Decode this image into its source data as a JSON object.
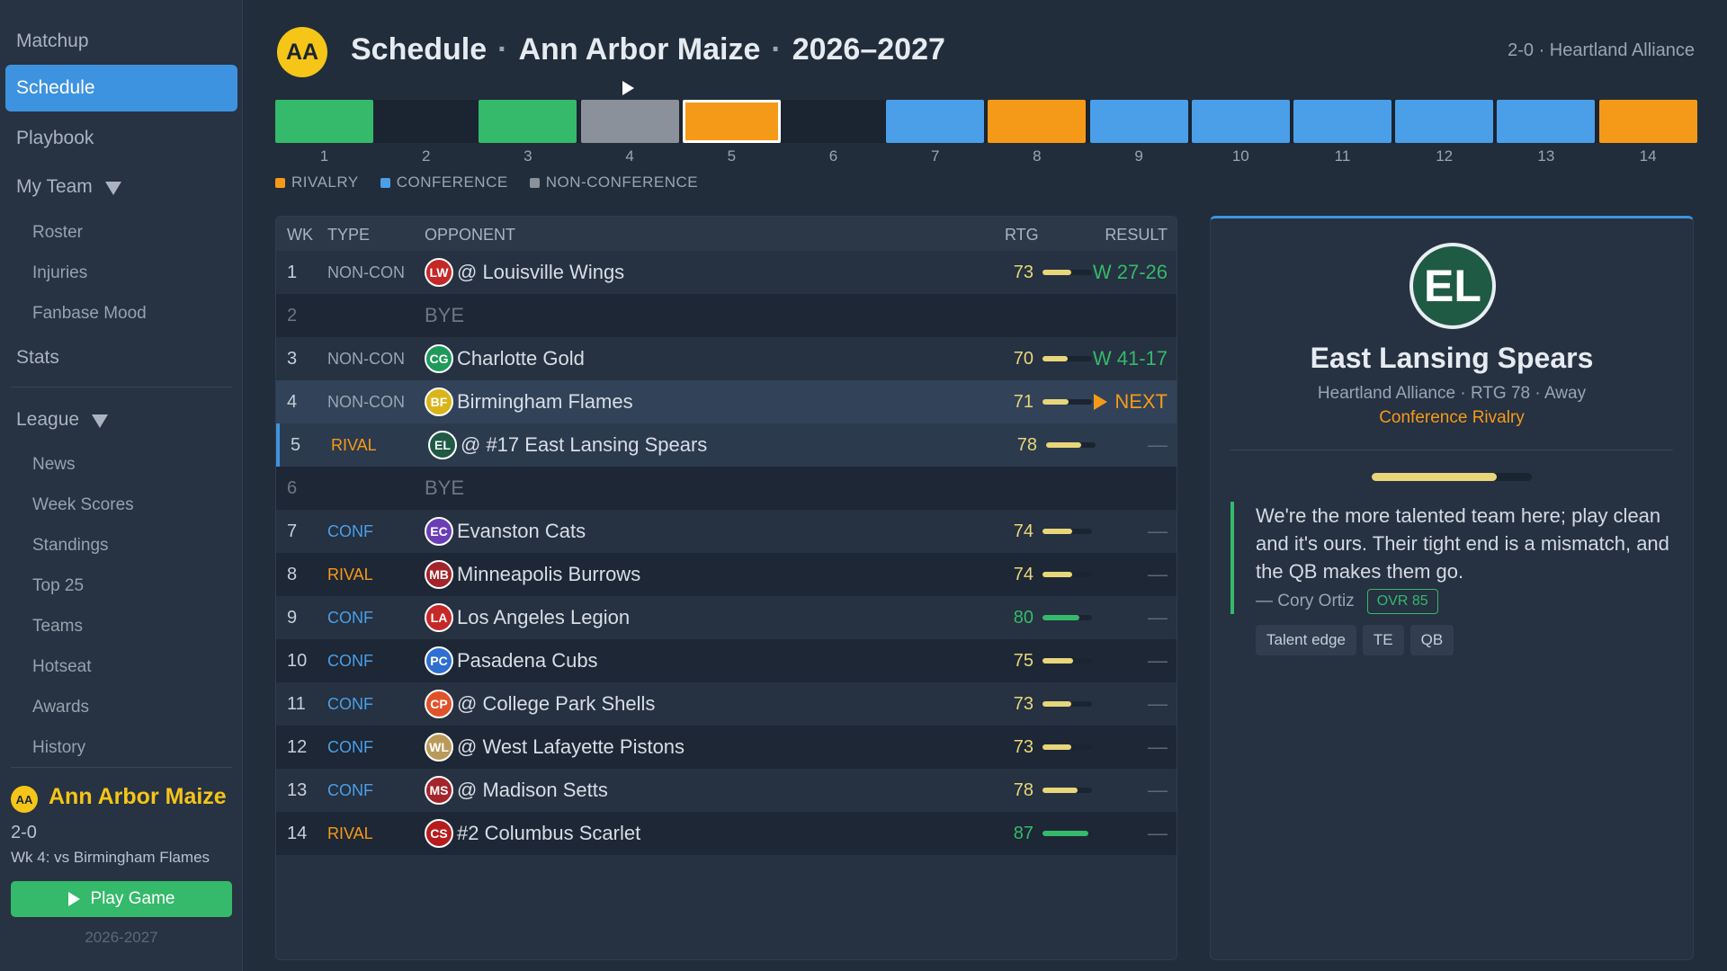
{
  "sidebar": {
    "nav": {
      "matchup": "Matchup",
      "schedule": "Schedule",
      "playbook": "Playbook",
      "my_team": "My Team",
      "stats": "Stats",
      "league": "League"
    },
    "my_team_items": [
      "Roster",
      "Injuries",
      "Fanbase Mood"
    ],
    "league_items": [
      "News",
      "Week Scores",
      "Standings",
      "Top 25",
      "Teams",
      "Hotseat",
      "Awards",
      "History"
    ],
    "team": {
      "logo": "AA",
      "name": "Ann Arbor Maize",
      "record": "2-0",
      "next_game": "Wk 4: vs Birmingham Flames",
      "play_button": "Play Game",
      "season": "2026-2027"
    }
  },
  "header": {
    "logo": "AA",
    "page": "Schedule",
    "dot": "·",
    "team": "Ann Arbor Maize",
    "season": "2026–2027",
    "record_conf": "2-0  ·  Heartland Alliance"
  },
  "colors": {
    "win": "#35b96a",
    "conference": "#4a9fe8",
    "rivalry": "#f59a18",
    "non_conference": "#8a919b",
    "accent": "#3e93e0"
  },
  "week_strip": {
    "weeks": [
      "1",
      "2",
      "3",
      "4",
      "5",
      "6",
      "7",
      "8",
      "9",
      "10",
      "11",
      "12",
      "13",
      "14"
    ],
    "current_week": "4",
    "selected_week": "5"
  },
  "legend": {
    "rivalry": "RIVALRY",
    "conference": "CONFERENCE",
    "non_conference": "NON-CONFERENCE"
  },
  "table": {
    "headers": {
      "wk": "WK",
      "type": "TYPE",
      "opponent": "OPPONENT",
      "rtg": "RTG",
      "result": "RESULT"
    },
    "rows": [
      {
        "wk": "1",
        "type": "NON-CON",
        "kind": "nonconf",
        "logo": "LW",
        "logo_color": "#c62828",
        "opponent": "@ Louisville Wings",
        "rtg": "73",
        "result": "W 27-26",
        "status": "win"
      },
      {
        "wk": "2",
        "bye": "BYE"
      },
      {
        "wk": "3",
        "type": "NON-CON",
        "kind": "nonconf",
        "logo": "CG",
        "logo_color": "#1e9a5a",
        "opponent": "Charlotte Gold",
        "rtg": "70",
        "result": "W 41-17",
        "status": "win"
      },
      {
        "wk": "4",
        "type": "NON-CON",
        "kind": "nonconf",
        "logo": "BF",
        "logo_color": "#d9b51a",
        "opponent": "Birmingham Flames",
        "rtg": "71",
        "result": "NEXT",
        "status": "next"
      },
      {
        "wk": "5",
        "type": "RIVAL",
        "kind": "rival",
        "logo": "EL",
        "logo_color": "#1f5a45",
        "opponent": "@ #17 East Lansing Spears",
        "rtg": "78",
        "result": "—",
        "status": "upcoming"
      },
      {
        "wk": "6",
        "bye": "BYE"
      },
      {
        "wk": "7",
        "type": "CONF",
        "kind": "conf",
        "logo": "EC",
        "logo_color": "#6a3fb5",
        "opponent": "Evanston Cats",
        "rtg": "74",
        "result": "—",
        "status": "upcoming"
      },
      {
        "wk": "8",
        "type": "RIVAL",
        "kind": "rival",
        "logo": "MB",
        "logo_color": "#a3242a",
        "opponent": "Minneapolis Burrows",
        "rtg": "74",
        "result": "—",
        "status": "upcoming"
      },
      {
        "wk": "9",
        "type": "CONF",
        "kind": "conf",
        "logo": "LA",
        "logo_color": "#c62828",
        "opponent": "Los Angeles Legion",
        "rtg": "80",
        "result": "—",
        "status": "upcoming"
      },
      {
        "wk": "10",
        "type": "CONF",
        "kind": "conf",
        "logo": "PC",
        "logo_color": "#2f6fd1",
        "opponent": "Pasadena Cubs",
        "rtg": "75",
        "result": "—",
        "status": "upcoming"
      },
      {
        "wk": "11",
        "type": "CONF",
        "kind": "conf",
        "logo": "CP",
        "logo_color": "#e0522a",
        "opponent": "@ College Park Shells",
        "rtg": "73",
        "result": "—",
        "status": "upcoming"
      },
      {
        "wk": "12",
        "type": "CONF",
        "kind": "conf",
        "logo": "WL",
        "logo_color": "#b99a5a",
        "opponent": "@ West Lafayette Pistons",
        "rtg": "73",
        "result": "—",
        "status": "upcoming"
      },
      {
        "wk": "13",
        "type": "CONF",
        "kind": "conf",
        "logo": "MS",
        "logo_color": "#a3242a",
        "opponent": "@ Madison Setts",
        "rtg": "78",
        "result": "—",
        "status": "upcoming"
      },
      {
        "wk": "14",
        "type": "RIVAL",
        "kind": "rival",
        "logo": "CS",
        "logo_color": "#b71c1c",
        "opponent": "#2 Columbus Scarlet",
        "rtg": "87",
        "result": "—",
        "status": "upcoming"
      }
    ]
  },
  "detail": {
    "logo": "EL",
    "name": "East Lansing Spears",
    "meta": "Heartland Alliance  ·  RTG 78  ·  Away",
    "rivalry": "Conference Rivalry",
    "rating_level": 0.78,
    "quote": "We're the more talented team here; play clean and it's ours. Their tight end is a mismatch, and the QB makes them go.",
    "author": "— Cory Ortiz",
    "ovr": "OVR 85",
    "tags": [
      "Talent edge",
      "TE",
      "QB"
    ]
  }
}
